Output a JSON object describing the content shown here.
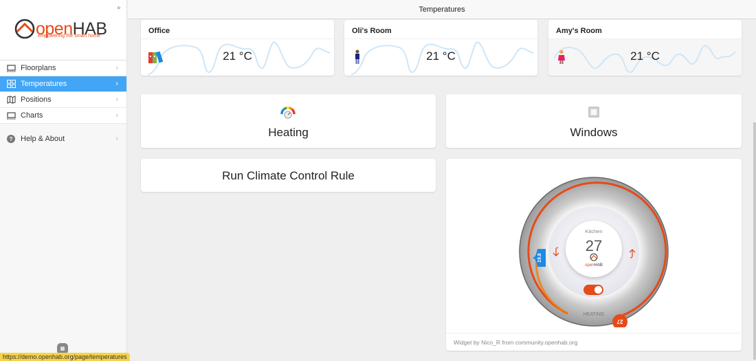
{
  "app": {
    "logo_open": "open",
    "logo_hab": "HAB",
    "tagline": "empowering the smart home",
    "brand_color": "#e64a19",
    "accent_color": "#42a5f5"
  },
  "sidebar": {
    "items": [
      {
        "label": "Floorplans",
        "icon": "monitor-icon",
        "active": false
      },
      {
        "label": "Temperatures",
        "icon": "grid-icon",
        "active": true
      },
      {
        "label": "Positions",
        "icon": "map-icon",
        "active": false
      },
      {
        "label": "Charts",
        "icon": "monitor-icon",
        "active": false
      }
    ],
    "help_label": "Help & About"
  },
  "status_bar": {
    "url": "https://demo.openhab.org/page/temperatures"
  },
  "header": {
    "title": "Temperatures"
  },
  "rooms": [
    {
      "name": "Office",
      "temperature": "21 °C",
      "icon": "folders-icon"
    },
    {
      "name": "Oli's Room",
      "temperature": "21 °C",
      "icon": "boy-icon"
    },
    {
      "name": "Amy's Room",
      "temperature": "21 °C",
      "icon": "girl-icon"
    }
  ],
  "tiles": {
    "heating": "Heating",
    "windows": "Windows",
    "rule": "Run Climate Control Rule"
  },
  "thermostat": {
    "room": "Kitchen",
    "target": "27",
    "current": "19.8",
    "setpoint_marker": "27",
    "mode": "HEATING",
    "heating_on": true,
    "logo_open": "open",
    "logo_hab": "HAB",
    "credit": "Widget by Nico_R from community.openhab.org"
  }
}
